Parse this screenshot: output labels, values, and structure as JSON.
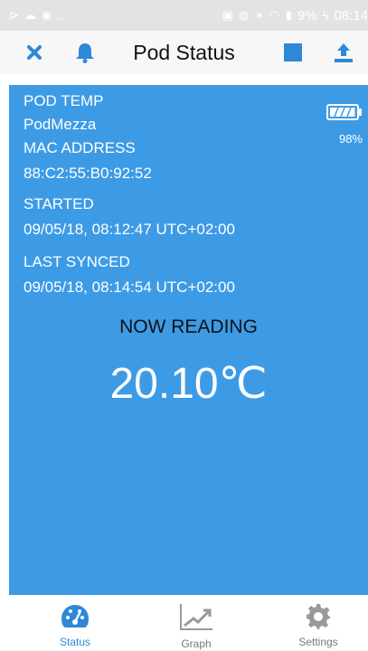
{
  "status_bar": {
    "left_text": "...",
    "battery_text": "9%",
    "time": "08:14"
  },
  "header": {
    "title": "Pod Status",
    "icons": {
      "close": "close-icon",
      "bell": "bell-icon",
      "stop": "stop-icon",
      "upload": "upload-icon"
    },
    "accent": "#2f87d8"
  },
  "pod": {
    "temp_label": "POD TEMP",
    "name": "PodMezza",
    "mac_label": "MAC ADDRESS",
    "mac": "88:C2:55:B0:92:52",
    "started_label": "STARTED",
    "started": "09/05/18, 08:12:47 UTC+02:00",
    "last_synced_label": "LAST SYNCED",
    "last_synced": "09/05/18, 08:14:54 UTC+02:00",
    "battery_percent": "98%",
    "battery_level": 0.98,
    "reading_label": "NOW READING",
    "reading": "20.10℃",
    "panel_color": "#3d9be6"
  },
  "nav": {
    "status": "Status",
    "graph": "Graph",
    "settings": "Settings",
    "active": "status"
  }
}
